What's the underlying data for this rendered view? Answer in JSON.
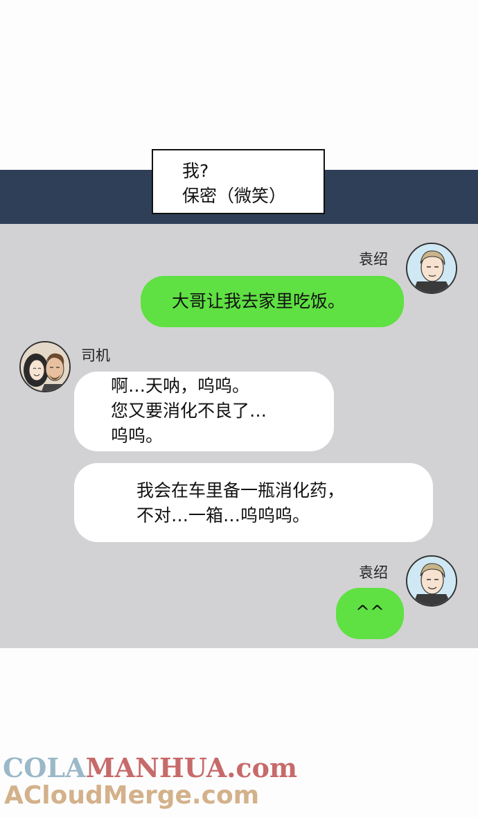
{
  "caption": {
    "line1": "我?",
    "line2": "保密（微笑）"
  },
  "messages": [
    {
      "sender": "袁绍",
      "text": "大哥让我去家里吃饭。"
    },
    {
      "sender": "司机",
      "text": "啊…天呐，呜呜。\n您又要消化不良了…\n呜呜。"
    },
    {
      "sender": "司机",
      "text": "我会在车里备一瓶消化药，\n不对…一箱…呜呜呜。"
    },
    {
      "sender": "袁绍",
      "text": "^^"
    }
  ],
  "watermark": {
    "part1": "COLA",
    "part2": "MANHUA.com",
    "line2": "ACloudMerge.com"
  },
  "colors": {
    "band": "#2f3f58",
    "chat_bg": "#d2d2d4",
    "green_bubble": "#5fe043",
    "white_bubble": "#ffffff"
  }
}
